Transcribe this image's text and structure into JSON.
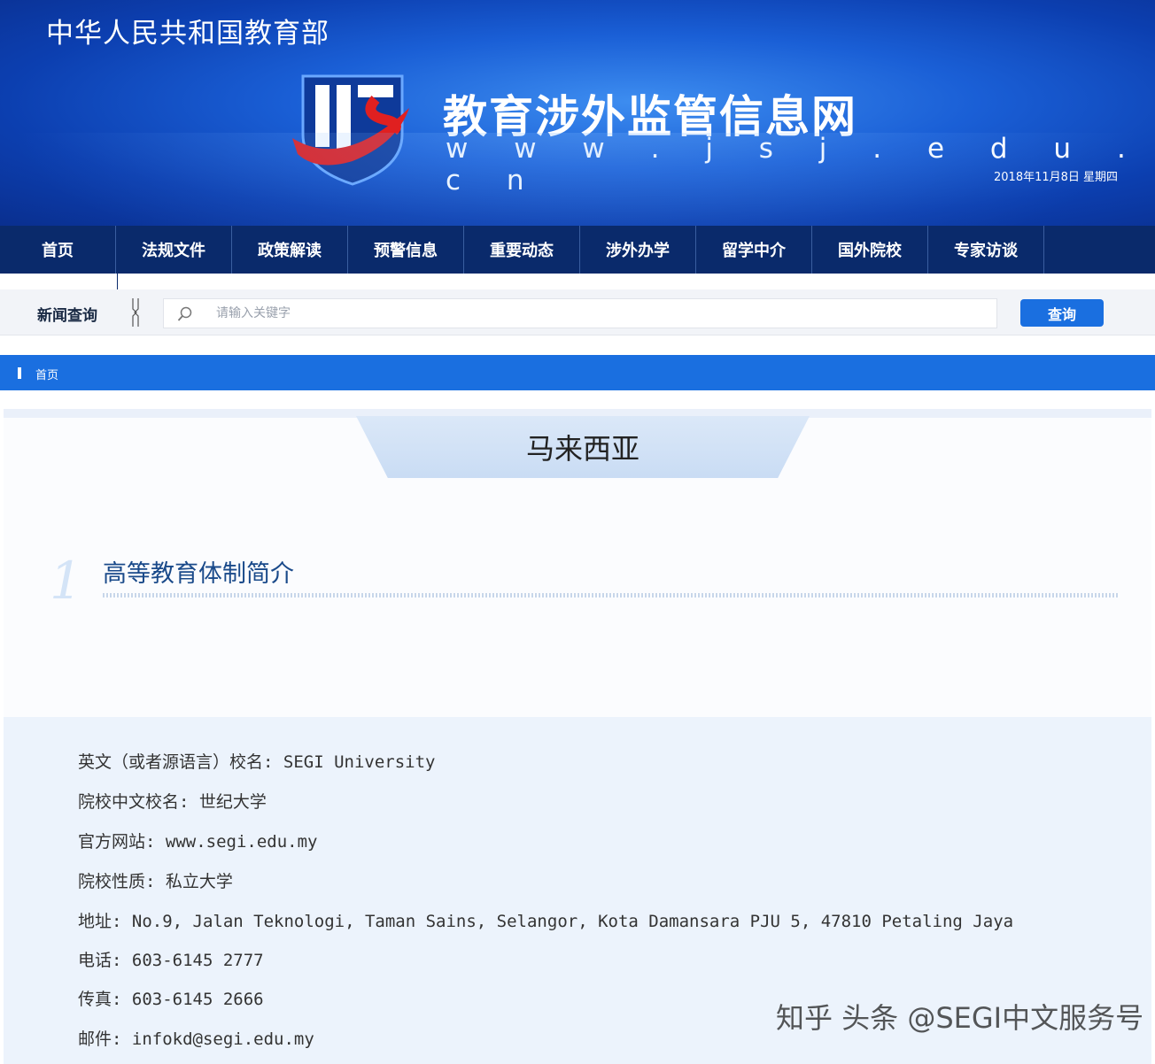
{
  "header": {
    "ministry": "中华人民共和国教育部",
    "site_title": "教育涉外监管信息网",
    "site_url": "w w w . j s j . e d u . c n",
    "date": "2018年11月8日 星期四"
  },
  "nav": {
    "items": [
      {
        "label": "首页"
      },
      {
        "label": "法规文件"
      },
      {
        "label": "政策解读"
      },
      {
        "label": "预警信息"
      },
      {
        "label": "重要动态"
      },
      {
        "label": "涉外办学"
      },
      {
        "label": "留学中介"
      },
      {
        "label": "国外院校"
      },
      {
        "label": "专家访谈"
      }
    ]
  },
  "search": {
    "label": "新闻查询",
    "placeholder": "请输入关键字",
    "button": "查询"
  },
  "breadcrumb": {
    "text": "首页"
  },
  "content": {
    "country": "马来西亚",
    "section_number": "1",
    "section_title": "高等教育体制简介",
    "info": [
      "英文（或者源语言）校名: SEGI University",
      "院校中文校名: 世纪大学",
      "官方网站:  www.segi.edu.my",
      "院校性质: 私立大学",
      "地址: No.9, Jalan Teknologi, Taman Sains, Selangor, Kota Damansara PJU 5, 47810 Petaling Jaya",
      "电话: 603-6145 2777",
      "传真: 603-6145 2666",
      "邮件: infokd@segi.edu.my"
    ]
  },
  "watermark": "知乎 头条 @SEGI中文服务号",
  "colors": {
    "banner_blue": "#1a5fd6",
    "nav_dark": "#0a2a6b",
    "accent_blue": "#1a6fe0",
    "logo_red": "#e02020"
  }
}
